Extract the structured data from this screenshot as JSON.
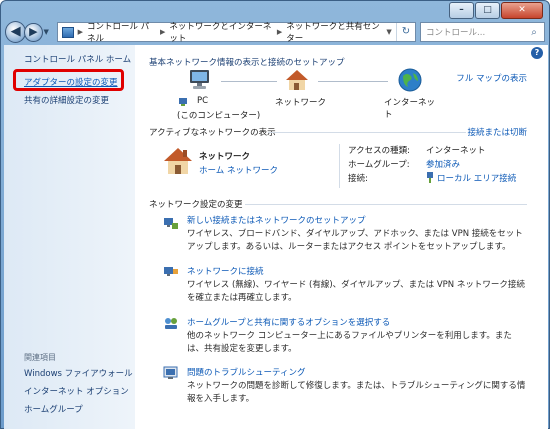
{
  "window": {
    "controls": {
      "minimize": "–",
      "maximize": "□",
      "close": "✕"
    }
  },
  "address": {
    "crumbs": [
      "コントロール パネル",
      "ネットワークとインターネット",
      "ネットワークと共有センター"
    ]
  },
  "search": {
    "placeholder": "コントロール..."
  },
  "sidebar": {
    "home": "コントロール パネル ホーム",
    "adapter": "アダプターの設定の変更",
    "advanced": "共有の詳細設定の変更",
    "seealso_title": "関連項目",
    "seealso": [
      "Windows ファイアウォール",
      "インターネット オプション",
      "ホームグループ"
    ]
  },
  "main": {
    "heading": "基本ネットワーク情報の表示と接続のセットアップ",
    "fullmap": "フル マップの表示",
    "map": {
      "pc_label": "PC",
      "pc_sub": "(このコンピューター)",
      "network_label": "ネットワーク",
      "internet_label": "インターネット"
    },
    "active_title": "アクティブなネットワークの表示",
    "connect_link": "接続または切断",
    "network_name": "ネットワーク",
    "network_type": "ホーム ネットワーク",
    "props": [
      {
        "label": "アクセスの種類:",
        "value": "インターネット"
      },
      {
        "label": "ホームグループ:",
        "value": "参加済み"
      },
      {
        "label": "接続:",
        "value": "ローカル エリア接続"
      }
    ],
    "settings_title": "ネットワーク設定の変更",
    "tasks": [
      {
        "title": "新しい接続またはネットワークのセットアップ",
        "desc": "ワイヤレス、ブロードバンド、ダイヤルアップ、アドホック、または VPN 接続をセットアップします。あるいは、ルーターまたはアクセス ポイントをセットアップします。"
      },
      {
        "title": "ネットワークに接続",
        "desc": "ワイヤレス (無線)、ワイヤード (有線)、ダイヤルアップ、または VPN ネットワーク接続を確立または再確立します。"
      },
      {
        "title": "ホームグループと共有に関するオプションを選択する",
        "desc": "他のネットワーク コンピューター上にあるファイルやプリンターを利用します。または、共有設定を変更します。"
      },
      {
        "title": "問題のトラブルシューティング",
        "desc": "ネットワークの問題を診断して修復します。または、トラブルシューティングに関する情報を入手します。"
      }
    ]
  },
  "help": "?"
}
